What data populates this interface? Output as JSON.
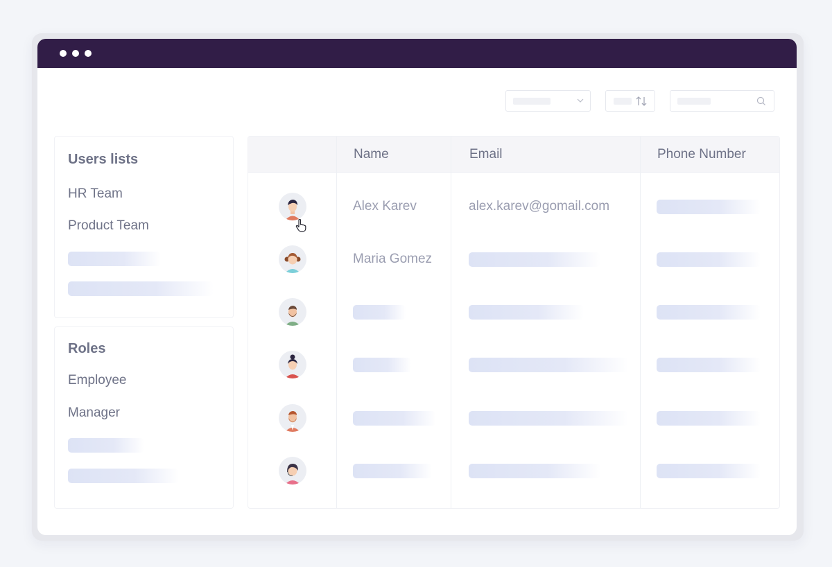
{
  "toolbar": {
    "dropdown_icon": "chevron-down-icon",
    "sort_icon": "sort-arrows-icon",
    "search_icon": "search-icon"
  },
  "sidebar": {
    "users_lists": {
      "title": "Users lists",
      "items": [
        "HR Team",
        "Product Team"
      ]
    },
    "roles": {
      "title": "Roles",
      "items": [
        "Employee",
        "Manager"
      ]
    }
  },
  "table": {
    "columns": [
      "",
      "Name",
      "Email",
      "Phone Number"
    ],
    "rows": [
      {
        "avatar": "avatar-man-dark-hair",
        "name": "Alex Karev",
        "email": "alex.karev@gomail.com",
        "phone": ""
      },
      {
        "avatar": "avatar-woman-pigtails",
        "name": "Maria Gomez",
        "email": "",
        "phone": ""
      },
      {
        "avatar": "avatar-man-beard",
        "name": "",
        "email": "",
        "phone": ""
      },
      {
        "avatar": "avatar-woman-bun",
        "name": "",
        "email": "",
        "phone": ""
      },
      {
        "avatar": "avatar-man-red-beard",
        "name": "",
        "email": "",
        "phone": ""
      },
      {
        "avatar": "avatar-woman-headset",
        "name": "",
        "email": "",
        "phone": ""
      }
    ]
  },
  "colors": {
    "titlebar": "#311d47",
    "background": "#f3f5f9",
    "skeleton": "#dde3f5",
    "text": "#6e7287",
    "muted_text": "#9a9db0"
  }
}
